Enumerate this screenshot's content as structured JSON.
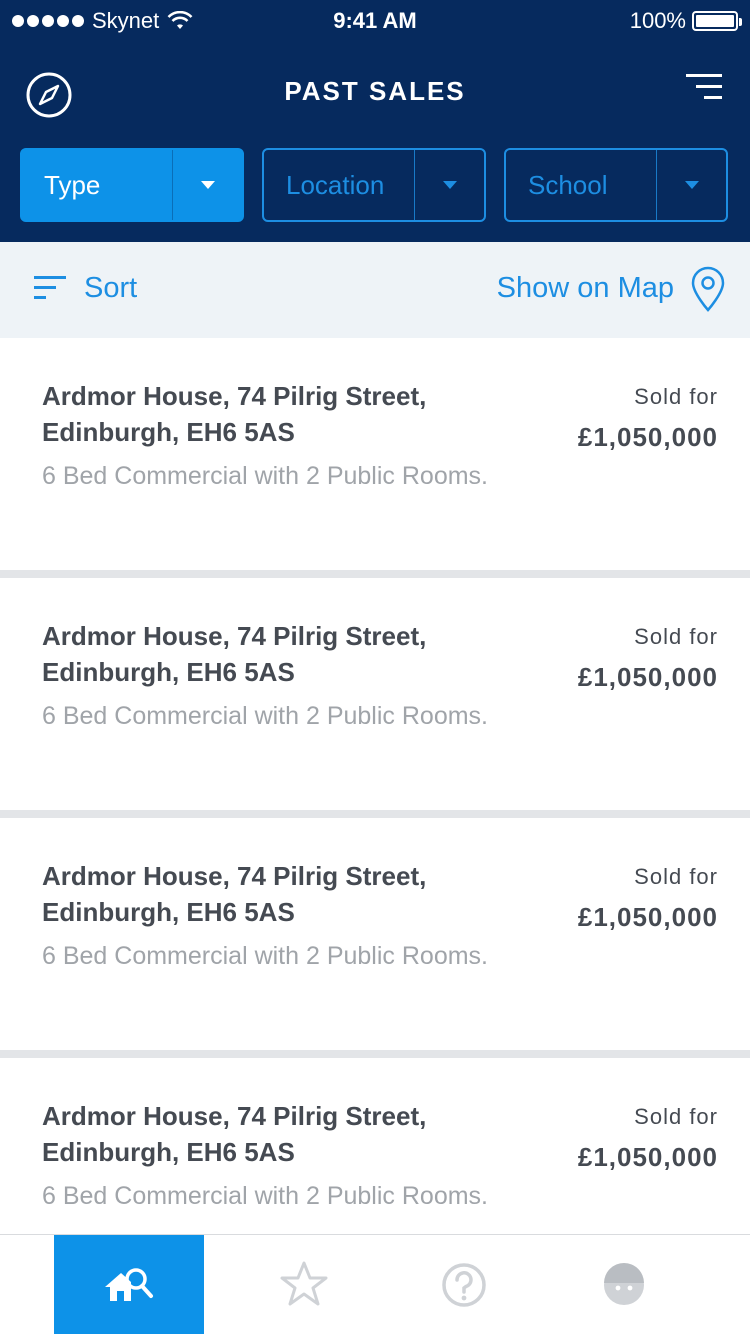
{
  "status_bar": {
    "carrier": "Skynet",
    "time": "9:41 AM",
    "battery": "100%"
  },
  "nav": {
    "title": "PAST SALES",
    "left_icon": "compass-icon",
    "right_icon": "menu-icon"
  },
  "filters": [
    {
      "label": "Type",
      "active": true
    },
    {
      "label": "Location",
      "active": false
    },
    {
      "label": "School",
      "active": false
    }
  ],
  "sortbar": {
    "sort_label": "Sort",
    "map_label": "Show on Map"
  },
  "listings": [
    {
      "address_line1": "Ardmor House, 74 Pilrig Street,",
      "address_line2": "Edinburgh, EH6 5AS",
      "description": "6 Bed Commercial with 2 Public Rooms.",
      "sold_label": "Sold for",
      "price": "£1,050,000"
    },
    {
      "address_line1": "Ardmor House, 74 Pilrig Street,",
      "address_line2": "Edinburgh, EH6 5AS",
      "description": "6 Bed Commercial with 2 Public Rooms.",
      "sold_label": "Sold for",
      "price": "£1,050,000"
    },
    {
      "address_line1": "Ardmor House, 74 Pilrig Street,",
      "address_line2": "Edinburgh, EH6 5AS",
      "description": "6 Bed Commercial with 2 Public Rooms.",
      "sold_label": "Sold for",
      "price": "£1,050,000"
    },
    {
      "address_line1": "Ardmor House, 74 Pilrig Street,",
      "address_line2": "Edinburgh, EH6 5AS",
      "description": "6 Bed Commercial with 2 Public Rooms.",
      "sold_label": "Sold for",
      "price": "£1,050,000"
    }
  ],
  "tabbar": [
    {
      "icon": "home-search-icon",
      "active": true
    },
    {
      "icon": "star-icon",
      "active": false
    },
    {
      "icon": "help-icon",
      "active": false
    },
    {
      "icon": "profile-icon",
      "active": false
    }
  ],
  "colors": {
    "header": "#062a5e",
    "accent": "#0d92e8",
    "sortbar_bg": "#eef3f7",
    "text_dark": "#454a52",
    "text_muted": "#a0a4a9"
  }
}
